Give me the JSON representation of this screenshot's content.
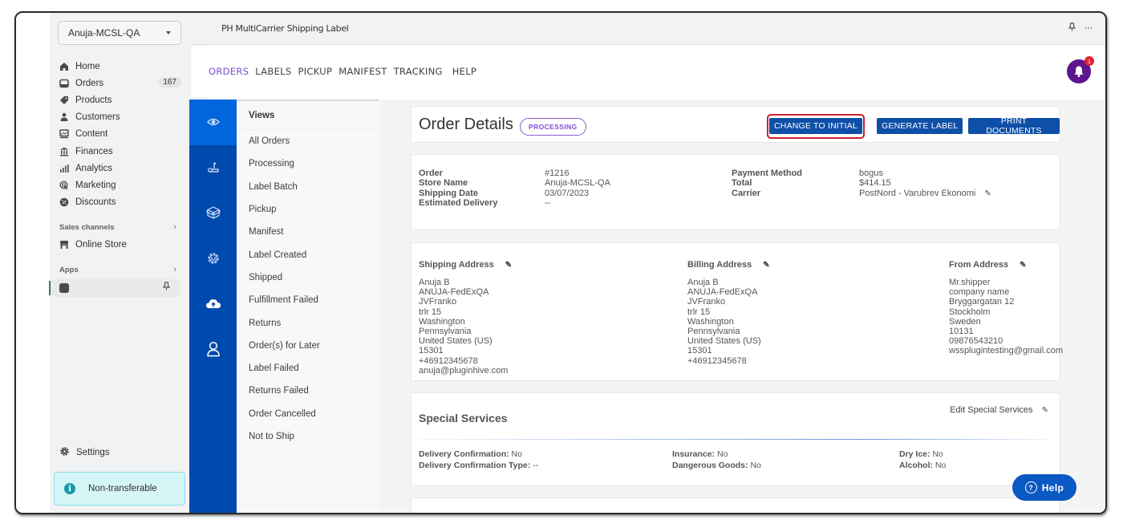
{
  "shop_nav": {
    "store_name": "Anuja-MCSL-QA",
    "items": [
      {
        "label": "Home",
        "icon": "home-icon"
      },
      {
        "label": "Orders",
        "icon": "orders-icon",
        "count": "167"
      },
      {
        "label": "Products",
        "icon": "tag-icon"
      },
      {
        "label": "Customers",
        "icon": "person-icon"
      },
      {
        "label": "Content",
        "icon": "content-icon"
      },
      {
        "label": "Finances",
        "icon": "bank-icon"
      },
      {
        "label": "Analytics",
        "icon": "bar-chart-icon"
      },
      {
        "label": "Marketing",
        "icon": "target-icon"
      },
      {
        "label": "Discounts",
        "icon": "discount-icon"
      }
    ],
    "sales_channels_label": "Sales channels",
    "online_store_label": "Online Store",
    "apps_label": "Apps",
    "settings_label": "Settings",
    "non_transferable_label": "Non-transferable"
  },
  "app": {
    "title": "PH MultiCarrier Shipping Label",
    "tabs": [
      {
        "label": "ORDERS",
        "active": true
      },
      {
        "label": "LABELS"
      },
      {
        "label": "PICKUP"
      },
      {
        "label": "MANIFEST"
      },
      {
        "label": "TRACKING"
      },
      {
        "label": "HELP"
      }
    ],
    "notification_count": "1"
  },
  "views": {
    "heading": "Views",
    "items": [
      "All Orders",
      "Processing",
      "Label Batch",
      "Pickup",
      "Manifest",
      "Label Created",
      "Shipped",
      "Fulfillment Failed",
      "Returns",
      "Order(s) for Later",
      "Label Failed",
      "Returns Failed",
      "Order Cancelled",
      "Not to Ship"
    ]
  },
  "order": {
    "title": "Order Details",
    "status": "PROCESSING",
    "buttons": {
      "change_to_initial": "CHANGE TO INITIAL",
      "generate_label": "GENERATE LABEL",
      "print_documents": "PRINT DOCUMENTS"
    },
    "fields_left": [
      {
        "key": "Order",
        "value": "#1216"
      },
      {
        "key": "Store Name",
        "value": "Anuja-MCSL-QA"
      },
      {
        "key": "Shipping Date",
        "value": "03/07/2023"
      },
      {
        "key": "Estimated Delivery",
        "value": "--"
      }
    ],
    "fields_right": [
      {
        "key": "Payment Method",
        "value": "bogus"
      },
      {
        "key": "Total",
        "value": "$414.15"
      },
      {
        "key": "Carrier",
        "value": "PostNord - Varubrev Ekonomi"
      }
    ]
  },
  "addresses": {
    "shipping": {
      "heading": "Shipping Address",
      "lines": [
        "Anuja B",
        "ANUJA-FedExQA",
        "JVFranko",
        "trlr 15",
        "Washington",
        "Pennsylvania",
        "United States (US)",
        "15301",
        "+46912345678",
        "anuja@pluginhive.com"
      ]
    },
    "billing": {
      "heading": "Billing Address",
      "lines": [
        "Anuja B",
        "ANUJA-FedExQA",
        "JVFranko",
        "trlr 15",
        "Washington",
        "Pennsylvania",
        "United States (US)",
        "15301",
        "+46912345678"
      ]
    },
    "from": {
      "heading": "From Address",
      "lines": [
        "Mr.shipper",
        "company name",
        "Bryggargatan 12",
        "Stockholm",
        "Sweden",
        "10131",
        "09876543210",
        "wssplugintesting@gmail.com"
      ]
    }
  },
  "special_services": {
    "title": "Special Services",
    "edit_label": "Edit Special Services",
    "items": [
      {
        "key": "Delivery Confirmation:",
        "value": "No"
      },
      {
        "key": "Delivery Confirmation Type:",
        "value": "--"
      },
      {
        "key": "Insurance:",
        "value": "No"
      },
      {
        "key": "Dangerous Goods:",
        "value": "No"
      },
      {
        "key": "Dry Ice:",
        "value": "No"
      },
      {
        "key": "Alcohol:",
        "value": "No"
      }
    ]
  },
  "help_button": "Help",
  "colors": {
    "primary_button": "#0e4fa8",
    "icon_rail": "#004aad",
    "icon_rail_active": "#0066dd",
    "status_badge": "#7a4fcf",
    "highlight_ring": "#c8202f",
    "bell": "#5c158d"
  }
}
